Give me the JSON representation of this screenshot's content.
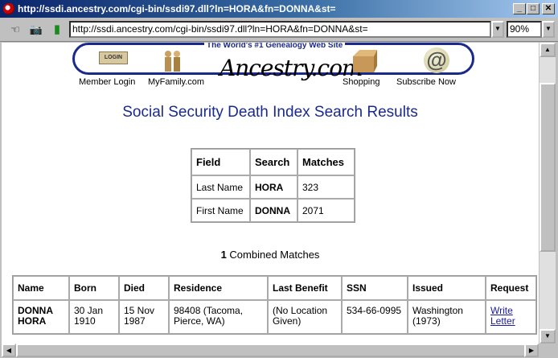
{
  "window": {
    "title": "http://ssdi.ancestry.com/cgi-bin/ssdi97.dll?ln=HORA&fn=DONNA&st=",
    "minimize_label": "_",
    "maximize_label": "□",
    "close_label": "✕"
  },
  "toolbar": {
    "url": "http://ssdi.ancestry.com/cgi-bin/ssdi97.dll?ln=HORA&fn=DONNA&st=",
    "zoom": "90%"
  },
  "banner": {
    "tagline": "The World's #1 Genealogy Web Site",
    "logo": "Ancestry.com",
    "login_button": "LOGIN",
    "nav": [
      "Member Login",
      "MyFamily.com",
      "Shopping",
      "Subscribe Now"
    ]
  },
  "page": {
    "title": "Social Security Death Index Search Results"
  },
  "search_table": {
    "headers": [
      "Field",
      "Search",
      "Matches"
    ],
    "rows": [
      [
        "Last Name",
        "HORA",
        "323"
      ],
      [
        "First Name",
        "DONNA",
        "2071"
      ]
    ]
  },
  "combined": {
    "count": "1",
    "label": "Combined Matches"
  },
  "results_table": {
    "headers": [
      "Name",
      "Born",
      "Died",
      "Residence",
      "Last Benefit",
      "SSN",
      "Issued",
      "Request"
    ],
    "rows": [
      {
        "name_line1": "DONNA",
        "name_line2": "HORA",
        "born_line1": "30 Jan",
        "born_line2": "1910",
        "died_line1": "15 Nov",
        "died_line2": "1987",
        "residence_line1": "98408 (Tacoma,",
        "residence_line2": "Pierce, WA)",
        "benefit_line1": "(No Location",
        "benefit_line2": "Given)",
        "ssn": "534-66-0995",
        "issued_line1": "Washington",
        "issued_line2": "(1973)",
        "request_line1": "Write",
        "request_line2": "Letter"
      }
    ]
  }
}
